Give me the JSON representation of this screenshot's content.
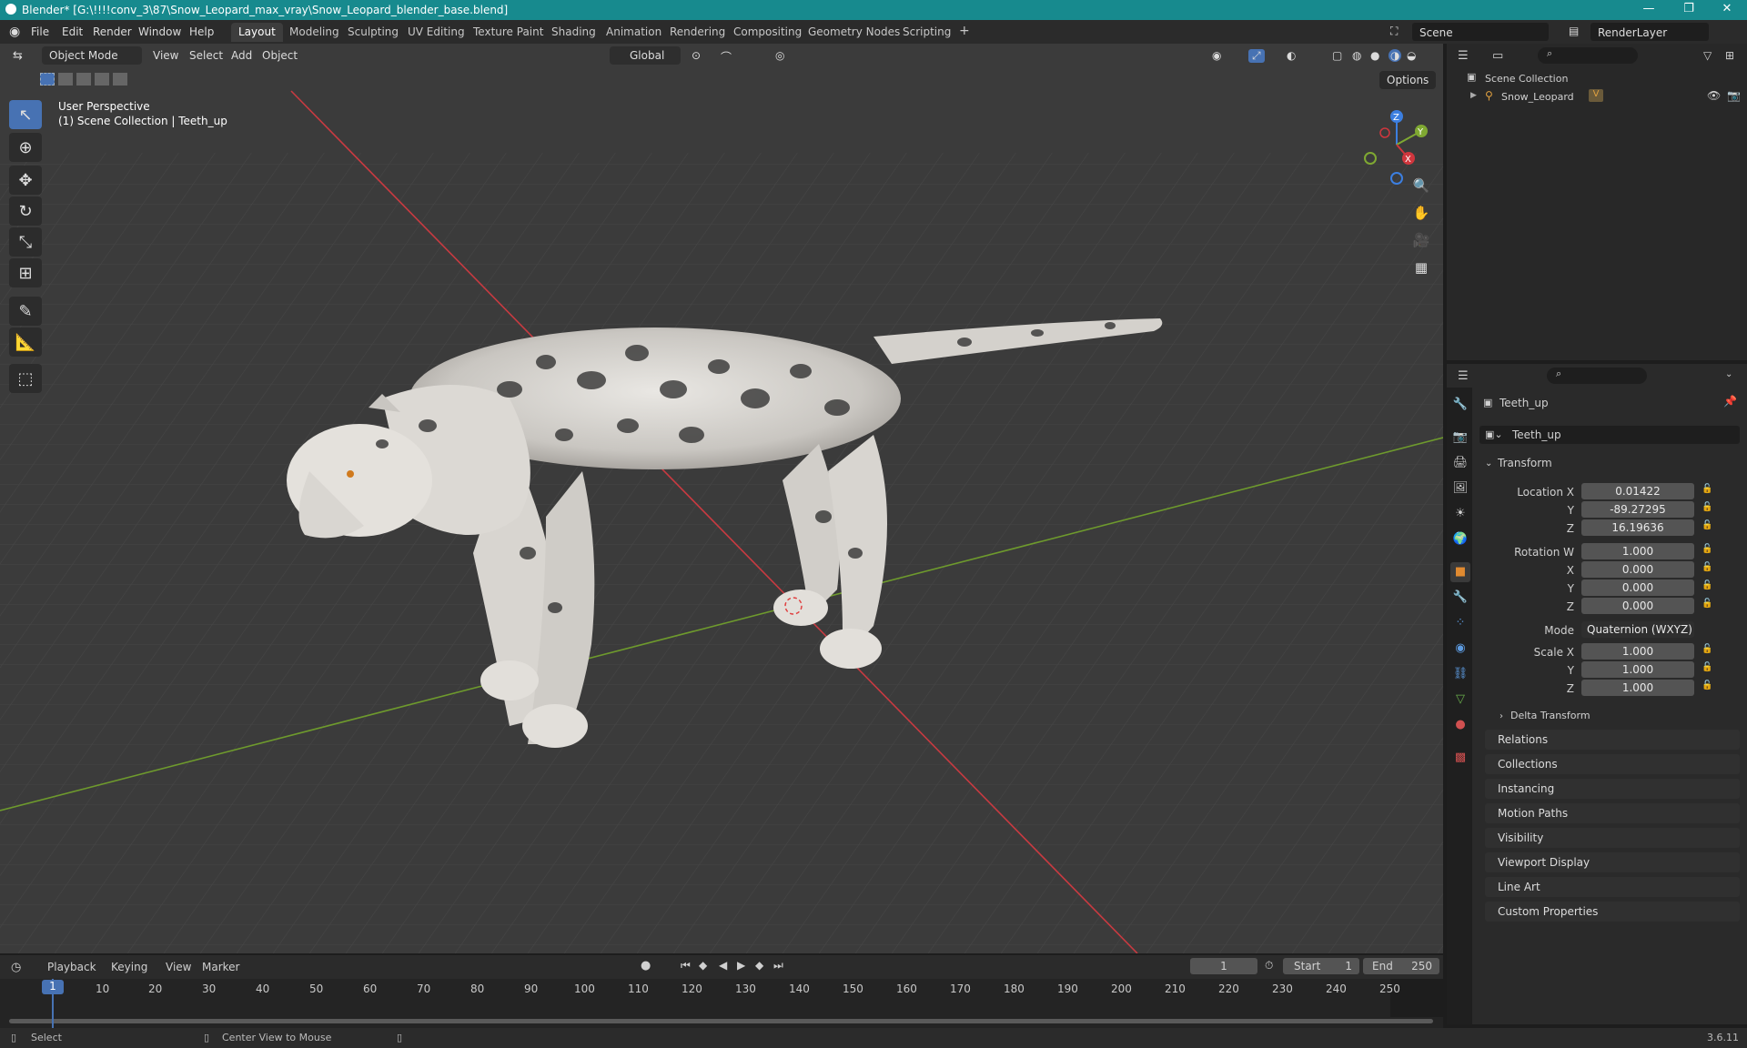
{
  "window": {
    "title": "Blender* [G:\\!!!!conv_3\\87\\Snow_Leopard_max_vray\\Snow_Leopard_blender_base.blend]",
    "minimize": "—",
    "maximize": "❐",
    "close": "✕"
  },
  "menubar": {
    "items": [
      "File",
      "Edit",
      "Render",
      "Window",
      "Help"
    ]
  },
  "workspaces": [
    "Layout",
    "Modeling",
    "Sculpting",
    "UV Editing",
    "Texture Paint",
    "Shading",
    "Animation",
    "Rendering",
    "Compositing",
    "Geometry Nodes",
    "Scripting"
  ],
  "workspace_add": "+",
  "scene": {
    "label": "Scene",
    "render_layer": "RenderLayer"
  },
  "viewport": {
    "mode": "Object Mode",
    "menus": [
      "View",
      "Select",
      "Add",
      "Object"
    ],
    "orientation": "Global",
    "options_label": "Options",
    "overlay_line1": "User Perspective",
    "overlay_line2": "(1) Scene Collection | Teeth_up",
    "gizmo": {
      "z": "Z",
      "y": "Y",
      "x": "X"
    }
  },
  "outliner": {
    "root": "Scene Collection",
    "items": [
      {
        "name": "Snow_Leopard"
      }
    ]
  },
  "properties": {
    "object_name": "Teeth_up",
    "data_name": "Teeth_up",
    "transform_title": "Transform",
    "location": {
      "label_x": "Location X",
      "label_y": "Y",
      "label_z": "Z",
      "x": "0.01422",
      "y": "-89.27295",
      "z": "16.19636"
    },
    "rotation": {
      "label_w": "Rotation W",
      "label_x": "X",
      "label_y": "Y",
      "label_z": "Z",
      "w": "1.000",
      "x": "0.000",
      "y": "0.000",
      "z": "0.000"
    },
    "mode_label": "Mode",
    "mode_value": "Quaternion (WXYZ)",
    "scale": {
      "label_x": "Scale X",
      "label_y": "Y",
      "label_z": "Z",
      "x": "1.000",
      "y": "1.000",
      "z": "1.000"
    },
    "delta_transform": "Delta Transform",
    "panels": [
      "Relations",
      "Collections",
      "Instancing",
      "Motion Paths",
      "Visibility",
      "Viewport Display",
      "Line Art",
      "Custom Properties"
    ]
  },
  "timeline": {
    "menus": [
      "Playback",
      "Keying",
      "View",
      "Marker"
    ],
    "current_frame": "1",
    "start_label": "Start",
    "start": "1",
    "end_label": "End",
    "end": "250",
    "ticks": [
      "1",
      "10",
      "20",
      "30",
      "40",
      "50",
      "60",
      "70",
      "80",
      "90",
      "100",
      "110",
      "120",
      "130",
      "140",
      "150",
      "160",
      "170",
      "180",
      "190",
      "200",
      "210",
      "220",
      "230",
      "240",
      "250"
    ]
  },
  "statusbar": {
    "select": "Select",
    "center_view": "Center View to Mouse",
    "version": "3.6.11"
  },
  "colors": {
    "titlebar": "#178a8e",
    "accent": "#4772b3",
    "x_axis": "#d0363d",
    "y_axis": "#7fa832",
    "z_axis": "#3c7fe0"
  }
}
